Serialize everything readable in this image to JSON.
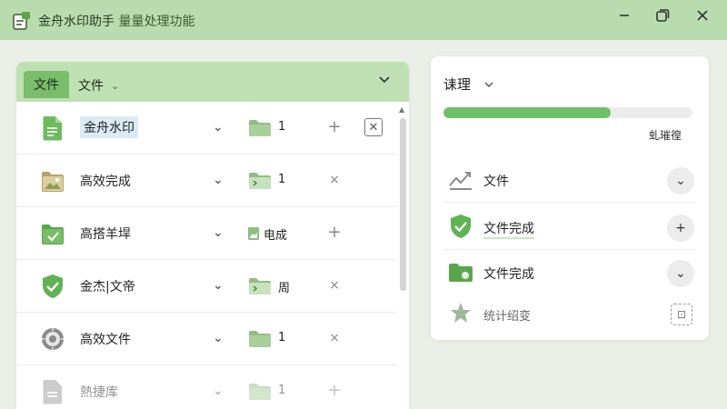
{
  "window": {
    "title": "金舟水印助手",
    "subtitle": "量量处理功能",
    "minimize_icon": "minimize-icon",
    "restore_icon": "restore-icon",
    "close_icon": "close-icon"
  },
  "left_panel": {
    "tab_active": "文件",
    "tab_dropdown": "文件",
    "rows": [
      {
        "name": "金舟水印",
        "icon": "document-icon",
        "folder_value": "1",
        "action": "+",
        "has_close": true
      },
      {
        "name": "高效完成",
        "icon": "image-folder-icon",
        "folder_value": "1",
        "action": "×",
        "has_close": false
      },
      {
        "name": "高搭羊垾",
        "icon": "check-folder-icon",
        "folder_value": "电成",
        "action": "+",
        "has_close": false
      },
      {
        "name": "金杰|文帝",
        "icon": "shield-check-icon",
        "folder_value": "周",
        "action": "×",
        "has_close": false
      },
      {
        "name": "高效文件",
        "icon": "gear-ring-icon",
        "folder_value": "1",
        "action": "×",
        "has_close": false
      },
      {
        "name": "熱捷库",
        "icon": "document-icon",
        "folder_value": "1",
        "action": "+",
        "has_close": false
      }
    ]
  },
  "right_panel": {
    "title": "诔理",
    "progress": 0.67,
    "progress_label": "虬璀徨",
    "items": [
      {
        "label": "文件",
        "icon": "chart-arrow-icon",
        "button": "⌄"
      },
      {
        "label": "文件完成",
        "icon": "shield-check-icon",
        "button": "+"
      },
      {
        "label": "文件完成",
        "icon": "folder-check-icon",
        "button": "⌄"
      },
      {
        "label": "统计绍变",
        "icon": "star-icon",
        "button": "⊡"
      }
    ]
  },
  "colors": {
    "titlebar": "#b9dcae",
    "accent": "#6cc067",
    "tab_active": "#79bd6b"
  }
}
